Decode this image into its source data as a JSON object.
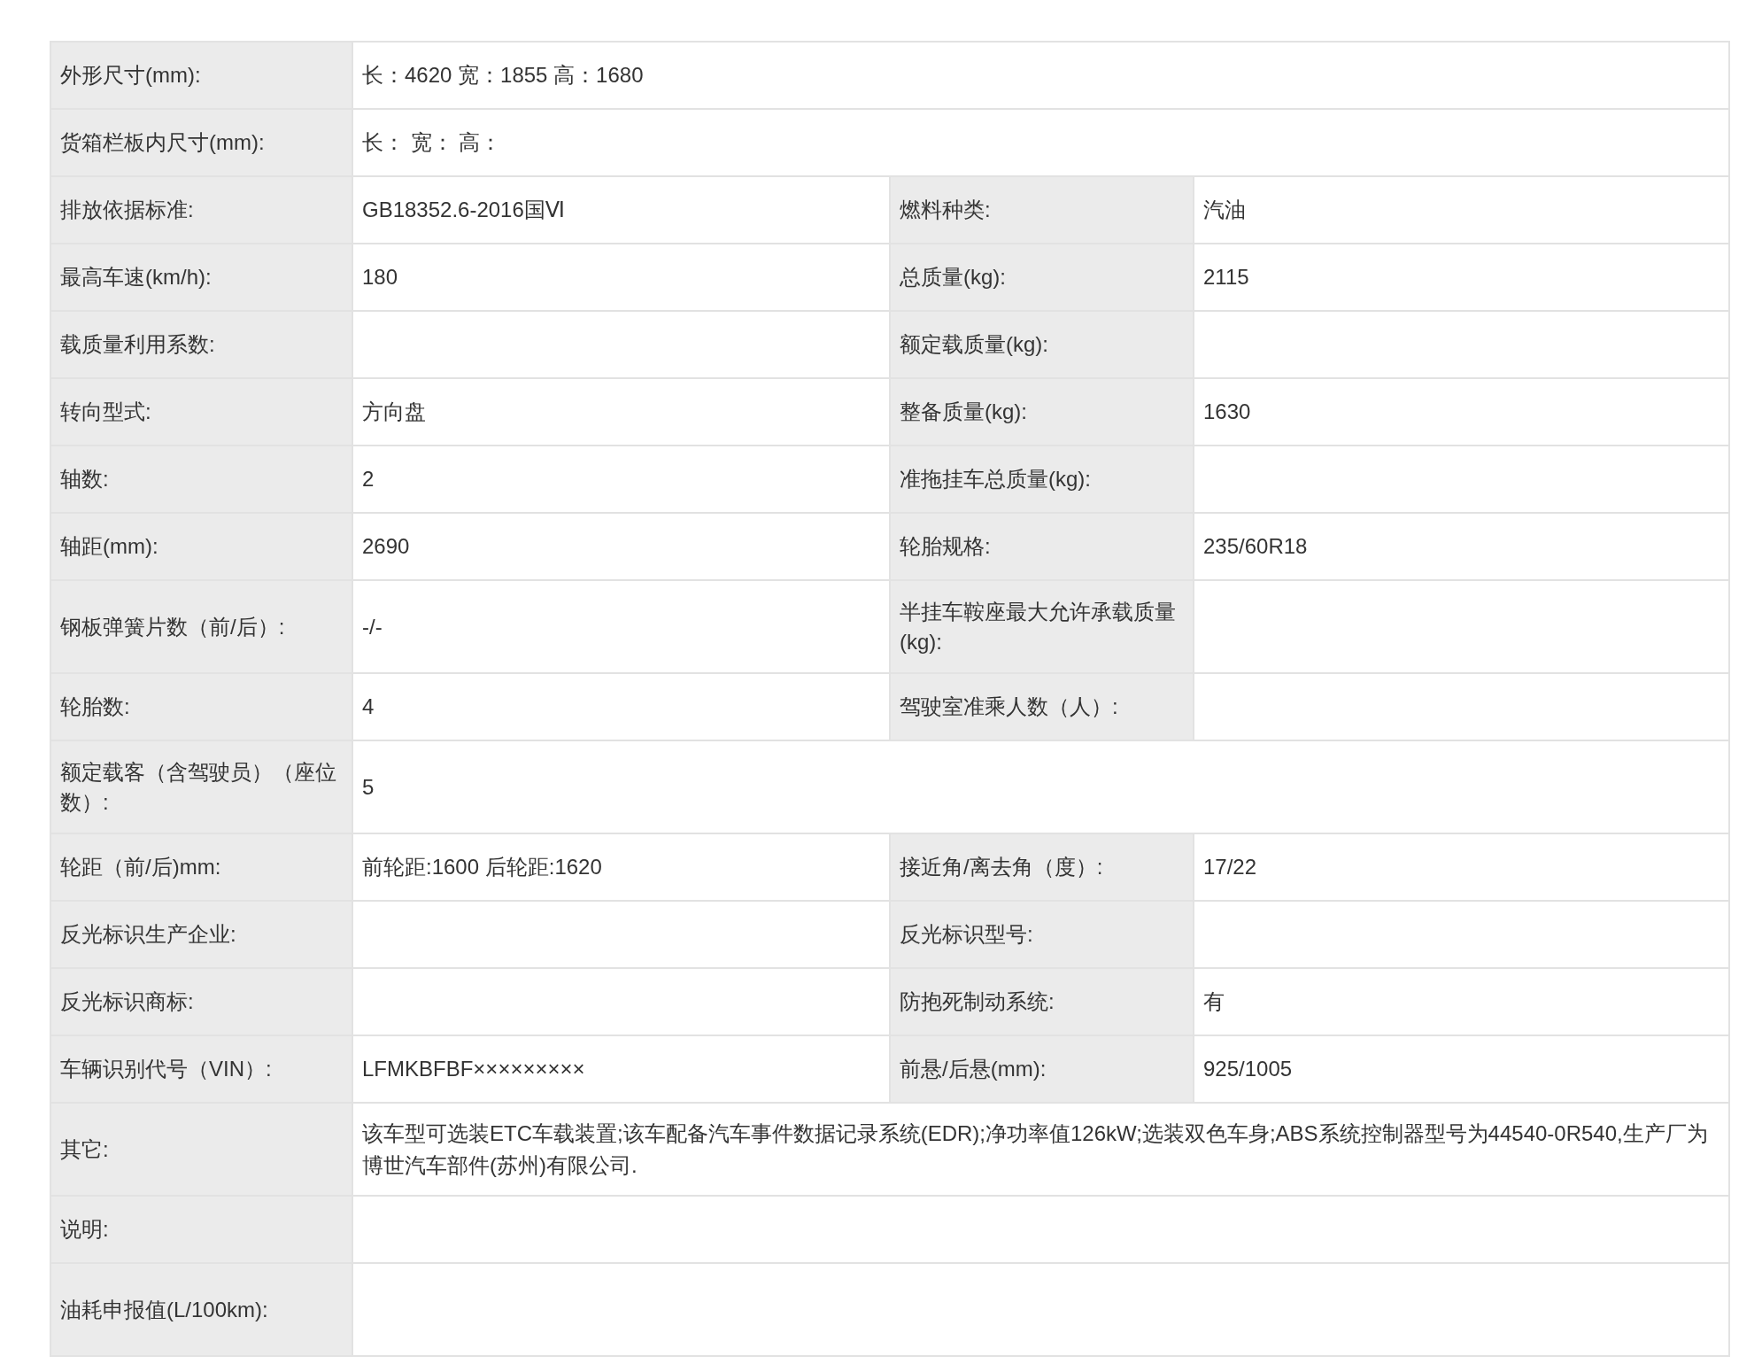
{
  "rows": [
    {
      "pairs": [
        {
          "label": "外形尺寸(mm):",
          "value": "长：4620 宽：1855 高：1680"
        }
      ]
    },
    {
      "pairs": [
        {
          "label": "货箱栏板内尺寸(mm):",
          "value": "长：  宽：  高："
        }
      ]
    },
    {
      "pairs": [
        {
          "label": "排放依据标准:",
          "value": "GB18352.6-2016国Ⅵ"
        },
        {
          "label": "燃料种类:",
          "value": "汽油"
        }
      ]
    },
    {
      "pairs": [
        {
          "label": "最高车速(km/h):",
          "value": "180"
        },
        {
          "label": "总质量(kg):",
          "value": "2115"
        }
      ]
    },
    {
      "pairs": [
        {
          "label": "载质量利用系数:"
        },
        {
          "label": "额定载质量(kg):"
        }
      ]
    },
    {
      "pairs": [
        {
          "label": "转向型式:",
          "value": "方向盘"
        },
        {
          "label": "整备质量(kg):",
          "value": "1630"
        }
      ]
    },
    {
      "pairs": [
        {
          "label": "轴数:",
          "value": "2"
        },
        {
          "label": "准拖挂车总质量(kg):"
        }
      ]
    },
    {
      "pairs": [
        {
          "label": "轴距(mm):",
          "value": "2690"
        },
        {
          "label": "轮胎规格:",
          "value": "235/60R18"
        }
      ]
    },
    {
      "pairs": [
        {
          "label": "钢板弹簧片数（前/后）:",
          "value": "-/-"
        },
        {
          "label": "半挂车鞍座最大允许承载质量(kg):"
        }
      ]
    },
    {
      "pairs": [
        {
          "label": "轮胎数:",
          "value": "4"
        },
        {
          "label": "驾驶室准乘人数（人）:"
        }
      ]
    },
    {
      "pairs": [
        {
          "label": "额定载客（含驾驶员）（座位数）:",
          "value": "5"
        }
      ]
    },
    {
      "pairs": [
        {
          "label": "轮距（前/后)mm:",
          "value": "前轮距:1600 后轮距:1620"
        },
        {
          "label": "接近角/离去角（度）:",
          "value": "17/22"
        }
      ]
    },
    {
      "pairs": [
        {
          "label": "反光标识生产企业:"
        },
        {
          "label": "反光标识型号:"
        }
      ]
    },
    {
      "pairs": [
        {
          "label": "反光标识商标:"
        },
        {
          "label": "防抱死制动系统:",
          "value": "有"
        }
      ]
    },
    {
      "pairs": [
        {
          "label": "车辆识别代号（VIN）:",
          "value": "LFMKBFBF×××××××××"
        },
        {
          "label": "前悬/后悬(mm):",
          "value": "925/1005"
        }
      ]
    },
    {
      "pairs": [
        {
          "label": "其它:",
          "value": "该车型可选装ETC车载装置;该车配备汽车事件数据记录系统(EDR);净功率值126kW;选装双色车身;ABS系统控制器型号为44540-0R540,生产厂为博世汽车部件(苏州)有限公司."
        }
      ]
    },
    {
      "pairs": [
        {
          "label": "说明:"
        }
      ]
    },
    {
      "pairs": [
        {
          "label": "油耗申报值(L/100km):"
        }
      ]
    }
  ]
}
